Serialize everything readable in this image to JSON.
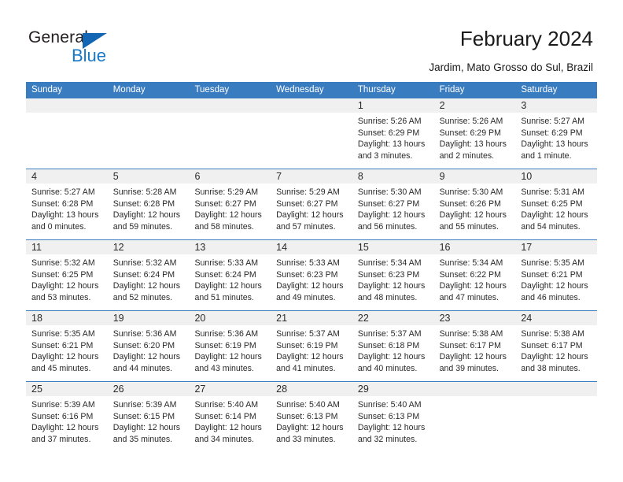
{
  "brand": {
    "name_part1": "General",
    "name_part2": "Blue",
    "triangle_color": "#1266b3",
    "blue_color": "#1878c8"
  },
  "header": {
    "title": "February 2024",
    "subtitle": "Jardim, Mato Grosso do Sul, Brazil"
  },
  "theme": {
    "header_blue": "#3a7cc0",
    "daynum_band": "#f0f0f0",
    "text": "#2a2a2a"
  },
  "weekdays": [
    "Sunday",
    "Monday",
    "Tuesday",
    "Wednesday",
    "Thursday",
    "Friday",
    "Saturday"
  ],
  "labels": {
    "sunrise_prefix": "Sunrise: ",
    "sunset_prefix": "Sunset: ",
    "daylight_prefix": "Daylight: "
  },
  "weeks": [
    [
      {
        "day": ""
      },
      {
        "day": ""
      },
      {
        "day": ""
      },
      {
        "day": ""
      },
      {
        "day": "1",
        "sunrise": "Sunrise: 5:26 AM",
        "sunset": "Sunset: 6:29 PM",
        "daylight_l1": "Daylight: 13 hours",
        "daylight_l2": "and 3 minutes."
      },
      {
        "day": "2",
        "sunrise": "Sunrise: 5:26 AM",
        "sunset": "Sunset: 6:29 PM",
        "daylight_l1": "Daylight: 13 hours",
        "daylight_l2": "and 2 minutes."
      },
      {
        "day": "3",
        "sunrise": "Sunrise: 5:27 AM",
        "sunset": "Sunset: 6:29 PM",
        "daylight_l1": "Daylight: 13 hours",
        "daylight_l2": "and 1 minute."
      }
    ],
    [
      {
        "day": "4",
        "sunrise": "Sunrise: 5:27 AM",
        "sunset": "Sunset: 6:28 PM",
        "daylight_l1": "Daylight: 13 hours",
        "daylight_l2": "and 0 minutes."
      },
      {
        "day": "5",
        "sunrise": "Sunrise: 5:28 AM",
        "sunset": "Sunset: 6:28 PM",
        "daylight_l1": "Daylight: 12 hours",
        "daylight_l2": "and 59 minutes."
      },
      {
        "day": "6",
        "sunrise": "Sunrise: 5:29 AM",
        "sunset": "Sunset: 6:27 PM",
        "daylight_l1": "Daylight: 12 hours",
        "daylight_l2": "and 58 minutes."
      },
      {
        "day": "7",
        "sunrise": "Sunrise: 5:29 AM",
        "sunset": "Sunset: 6:27 PM",
        "daylight_l1": "Daylight: 12 hours",
        "daylight_l2": "and 57 minutes."
      },
      {
        "day": "8",
        "sunrise": "Sunrise: 5:30 AM",
        "sunset": "Sunset: 6:27 PM",
        "daylight_l1": "Daylight: 12 hours",
        "daylight_l2": "and 56 minutes."
      },
      {
        "day": "9",
        "sunrise": "Sunrise: 5:30 AM",
        "sunset": "Sunset: 6:26 PM",
        "daylight_l1": "Daylight: 12 hours",
        "daylight_l2": "and 55 minutes."
      },
      {
        "day": "10",
        "sunrise": "Sunrise: 5:31 AM",
        "sunset": "Sunset: 6:25 PM",
        "daylight_l1": "Daylight: 12 hours",
        "daylight_l2": "and 54 minutes."
      }
    ],
    [
      {
        "day": "11",
        "sunrise": "Sunrise: 5:32 AM",
        "sunset": "Sunset: 6:25 PM",
        "daylight_l1": "Daylight: 12 hours",
        "daylight_l2": "and 53 minutes."
      },
      {
        "day": "12",
        "sunrise": "Sunrise: 5:32 AM",
        "sunset": "Sunset: 6:24 PM",
        "daylight_l1": "Daylight: 12 hours",
        "daylight_l2": "and 52 minutes."
      },
      {
        "day": "13",
        "sunrise": "Sunrise: 5:33 AM",
        "sunset": "Sunset: 6:24 PM",
        "daylight_l1": "Daylight: 12 hours",
        "daylight_l2": "and 51 minutes."
      },
      {
        "day": "14",
        "sunrise": "Sunrise: 5:33 AM",
        "sunset": "Sunset: 6:23 PM",
        "daylight_l1": "Daylight: 12 hours",
        "daylight_l2": "and 49 minutes."
      },
      {
        "day": "15",
        "sunrise": "Sunrise: 5:34 AM",
        "sunset": "Sunset: 6:23 PM",
        "daylight_l1": "Daylight: 12 hours",
        "daylight_l2": "and 48 minutes."
      },
      {
        "day": "16",
        "sunrise": "Sunrise: 5:34 AM",
        "sunset": "Sunset: 6:22 PM",
        "daylight_l1": "Daylight: 12 hours",
        "daylight_l2": "and 47 minutes."
      },
      {
        "day": "17",
        "sunrise": "Sunrise: 5:35 AM",
        "sunset": "Sunset: 6:21 PM",
        "daylight_l1": "Daylight: 12 hours",
        "daylight_l2": "and 46 minutes."
      }
    ],
    [
      {
        "day": "18",
        "sunrise": "Sunrise: 5:35 AM",
        "sunset": "Sunset: 6:21 PM",
        "daylight_l1": "Daylight: 12 hours",
        "daylight_l2": "and 45 minutes."
      },
      {
        "day": "19",
        "sunrise": "Sunrise: 5:36 AM",
        "sunset": "Sunset: 6:20 PM",
        "daylight_l1": "Daylight: 12 hours",
        "daylight_l2": "and 44 minutes."
      },
      {
        "day": "20",
        "sunrise": "Sunrise: 5:36 AM",
        "sunset": "Sunset: 6:19 PM",
        "daylight_l1": "Daylight: 12 hours",
        "daylight_l2": "and 43 minutes."
      },
      {
        "day": "21",
        "sunrise": "Sunrise: 5:37 AM",
        "sunset": "Sunset: 6:19 PM",
        "daylight_l1": "Daylight: 12 hours",
        "daylight_l2": "and 41 minutes."
      },
      {
        "day": "22",
        "sunrise": "Sunrise: 5:37 AM",
        "sunset": "Sunset: 6:18 PM",
        "daylight_l1": "Daylight: 12 hours",
        "daylight_l2": "and 40 minutes."
      },
      {
        "day": "23",
        "sunrise": "Sunrise: 5:38 AM",
        "sunset": "Sunset: 6:17 PM",
        "daylight_l1": "Daylight: 12 hours",
        "daylight_l2": "and 39 minutes."
      },
      {
        "day": "24",
        "sunrise": "Sunrise: 5:38 AM",
        "sunset": "Sunset: 6:17 PM",
        "daylight_l1": "Daylight: 12 hours",
        "daylight_l2": "and 38 minutes."
      }
    ],
    [
      {
        "day": "25",
        "sunrise": "Sunrise: 5:39 AM",
        "sunset": "Sunset: 6:16 PM",
        "daylight_l1": "Daylight: 12 hours",
        "daylight_l2": "and 37 minutes."
      },
      {
        "day": "26",
        "sunrise": "Sunrise: 5:39 AM",
        "sunset": "Sunset: 6:15 PM",
        "daylight_l1": "Daylight: 12 hours",
        "daylight_l2": "and 35 minutes."
      },
      {
        "day": "27",
        "sunrise": "Sunrise: 5:40 AM",
        "sunset": "Sunset: 6:14 PM",
        "daylight_l1": "Daylight: 12 hours",
        "daylight_l2": "and 34 minutes."
      },
      {
        "day": "28",
        "sunrise": "Sunrise: 5:40 AM",
        "sunset": "Sunset: 6:13 PM",
        "daylight_l1": "Daylight: 12 hours",
        "daylight_l2": "and 33 minutes."
      },
      {
        "day": "29",
        "sunrise": "Sunrise: 5:40 AM",
        "sunset": "Sunset: 6:13 PM",
        "daylight_l1": "Daylight: 12 hours",
        "daylight_l2": "and 32 minutes."
      },
      {
        "day": ""
      },
      {
        "day": ""
      }
    ]
  ]
}
